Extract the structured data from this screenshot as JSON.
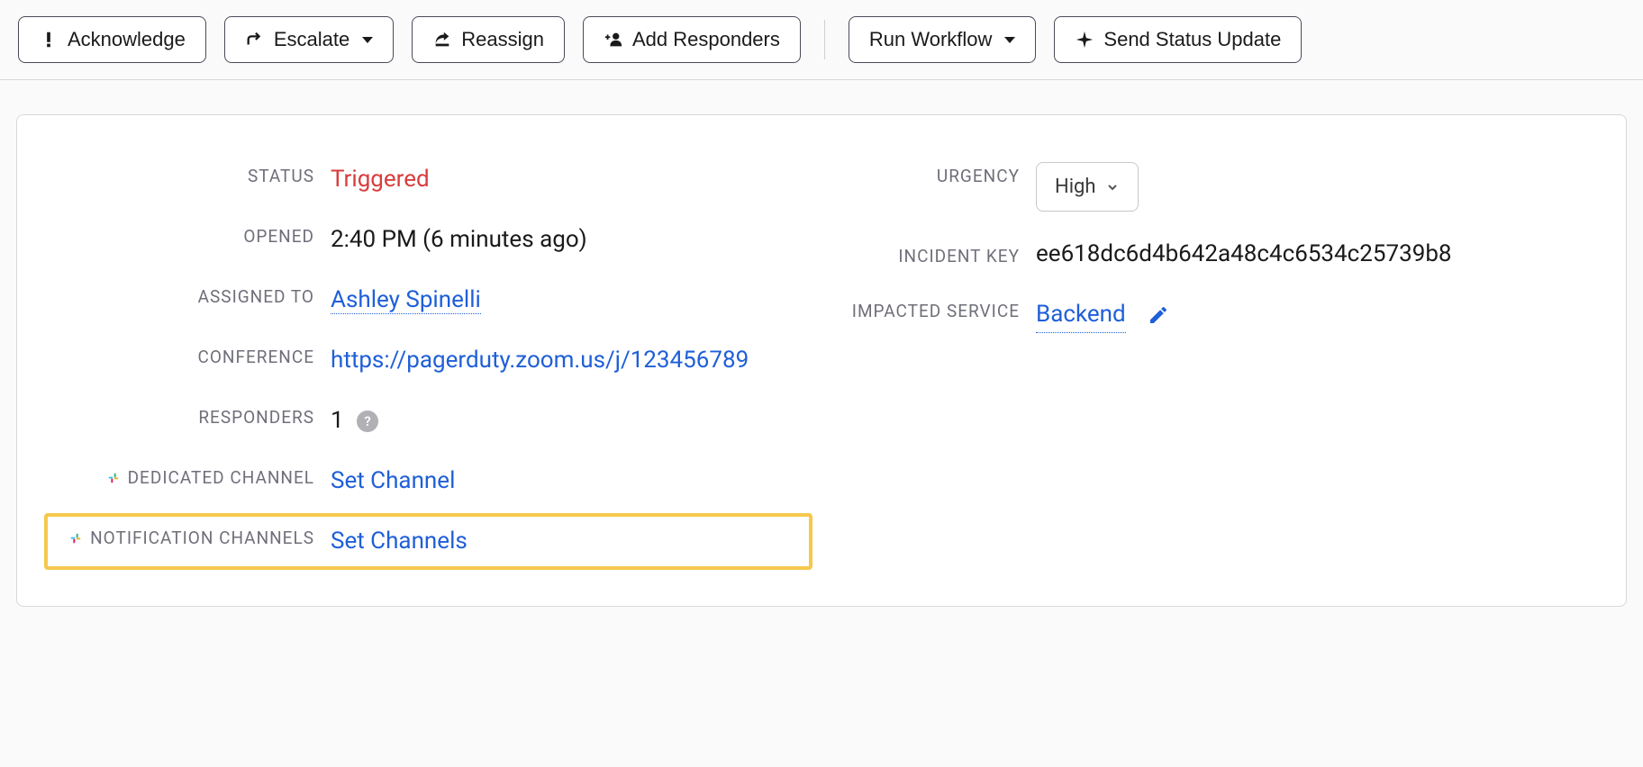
{
  "toolbar": {
    "acknowledge": "Acknowledge",
    "escalate": "Escalate",
    "reassign": "Reassign",
    "add_responders": "Add Responders",
    "run_workflow": "Run Workflow",
    "send_status_update": "Send Status Update"
  },
  "details": {
    "status_label": "STATUS",
    "status_value": "Triggered",
    "opened_label": "OPENED",
    "opened_value": "2:40 PM (6 minutes ago)",
    "assigned_label": "ASSIGNED TO",
    "assigned_value": "Ashley Spinelli",
    "conference_label": "CONFERENCE",
    "conference_value": "https://pagerduty.zoom.us/j/123456789",
    "responders_label": "RESPONDERS",
    "responders_value": "1",
    "dedicated_channel_label": "DEDICATED CHANNEL",
    "dedicated_channel_value": "Set Channel",
    "notification_channels_label": "NOTIFICATION CHANNELS",
    "notification_channels_value": "Set Channels",
    "urgency_label": "URGENCY",
    "urgency_value": "High",
    "incident_key_label": "INCIDENT KEY",
    "incident_key_value": "ee618dc6d4b642a48c4c6534c25739b8",
    "impacted_service_label": "IMPACTED SERVICE",
    "impacted_service_value": "Backend"
  }
}
